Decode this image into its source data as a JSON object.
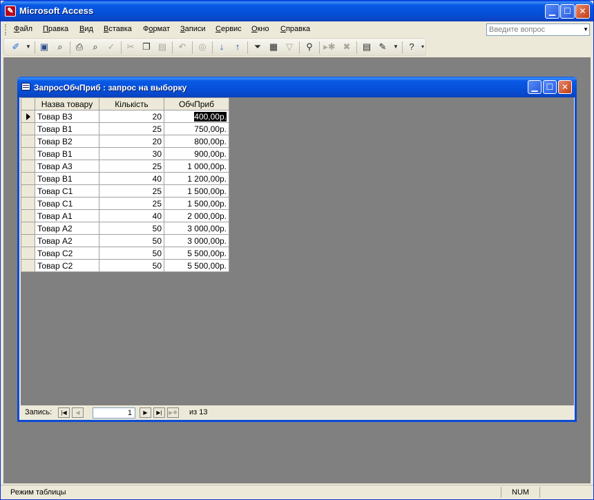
{
  "app": {
    "title": "Microsoft Access",
    "icon": "access-key-icon"
  },
  "menu": [
    {
      "label": "Файл",
      "key": "Ф",
      "rest": "айл"
    },
    {
      "label": "Правка",
      "key": "П",
      "rest": "равка"
    },
    {
      "label": "Вид",
      "key": "В",
      "rest": "ид"
    },
    {
      "label": "Вставка",
      "key": "В",
      "rest": "ставка"
    },
    {
      "label": "Формат",
      "key": "о",
      "pre": "Ф",
      "rest": "рмат"
    },
    {
      "label": "Записи",
      "key": "З",
      "rest": "аписи"
    },
    {
      "label": "Сервис",
      "key": "С",
      "rest": "ервис"
    },
    {
      "label": "Окно",
      "key": "О",
      "rest": "кно"
    },
    {
      "label": "Справка",
      "key": "С",
      "rest": "правка"
    }
  ],
  "help_box": {
    "placeholder": "Введите вопрос"
  },
  "toolbar_icons": [
    "view-design-icon",
    "save-icon",
    "search-file-icon",
    "print-icon",
    "print-preview-icon",
    "spelling-icon",
    "cut-icon",
    "copy-icon",
    "paste-icon",
    "undo-icon",
    "hyperlink-icon",
    "sort-ascending-icon",
    "sort-descending-icon",
    "filter-by-selection-icon",
    "filter-by-form-icon",
    "apply-filter-icon",
    "find-icon",
    "new-record-icon",
    "delete-record-icon",
    "database-window-icon",
    "new-object-icon",
    "help-icon"
  ],
  "child_window": {
    "title": "ЗапросОбчПриб : запрос на выборку",
    "columns": [
      "Назва товару",
      "Кількість",
      "ОбчПриб"
    ],
    "rows": [
      {
        "name": "Товар В3",
        "qty": "20",
        "profit": "400,00р."
      },
      {
        "name": "Товар В1",
        "qty": "25",
        "profit": "750,00р."
      },
      {
        "name": "Товар В2",
        "qty": "20",
        "profit": "800,00р."
      },
      {
        "name": "Товар В1",
        "qty": "30",
        "profit": "900,00р."
      },
      {
        "name": "Товар А3",
        "qty": "25",
        "profit": "1 000,00р."
      },
      {
        "name": "Товар В1",
        "qty": "40",
        "profit": "1 200,00р."
      },
      {
        "name": "Товар С1",
        "qty": "25",
        "profit": "1 500,00р."
      },
      {
        "name": "Товар С1",
        "qty": "25",
        "profit": "1 500,00р."
      },
      {
        "name": "Товар А1",
        "qty": "40",
        "profit": "2 000,00р."
      },
      {
        "name": "Товар А2",
        "qty": "50",
        "profit": "3 000,00р."
      },
      {
        "name": "Товар А2",
        "qty": "50",
        "profit": "3 000,00р."
      },
      {
        "name": "Товар С2",
        "qty": "50",
        "profit": "5 500,00р."
      },
      {
        "name": "Товар С2",
        "qty": "50",
        "profit": "5 500,00р."
      }
    ],
    "nav": {
      "label": "Запись:",
      "current": "1",
      "count": "из  13"
    }
  },
  "status": {
    "mode": "Режим таблицы",
    "num": "NUM"
  },
  "colors": {
    "titlebar": "#0a5ae6",
    "mdi_background": "#808080",
    "chrome": "#ece9d8"
  }
}
